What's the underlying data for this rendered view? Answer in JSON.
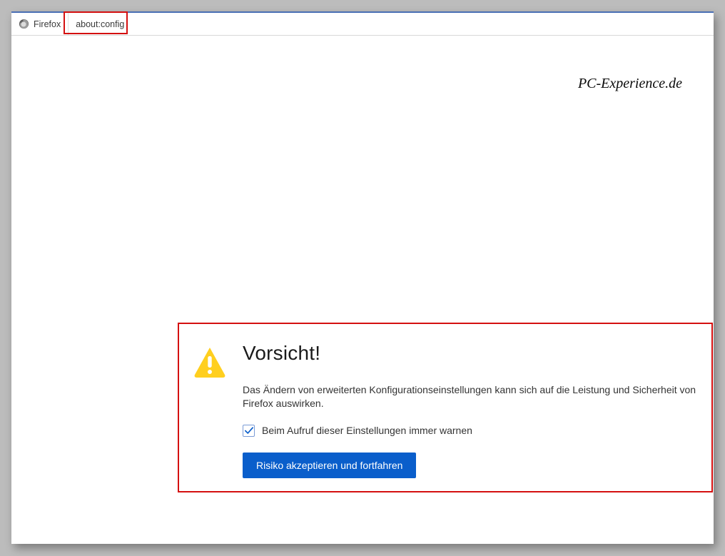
{
  "tabbar": {
    "app_label": "Firefox",
    "url": "about:config"
  },
  "watermark": "PC-Experience.de",
  "warning": {
    "title": "Vorsicht!",
    "body": "Das Ändern von erweiterten Konfigurationseinstellungen kann sich auf die Leistung und Sicherheit von Firefox auswirken.",
    "checkbox_label": "Beim Aufruf dieser Einstellungen immer warnen",
    "checkbox_checked": true,
    "accept_label": "Risiko akzeptieren und fortfahren"
  },
  "highlights": {
    "url": true,
    "panel": true
  }
}
